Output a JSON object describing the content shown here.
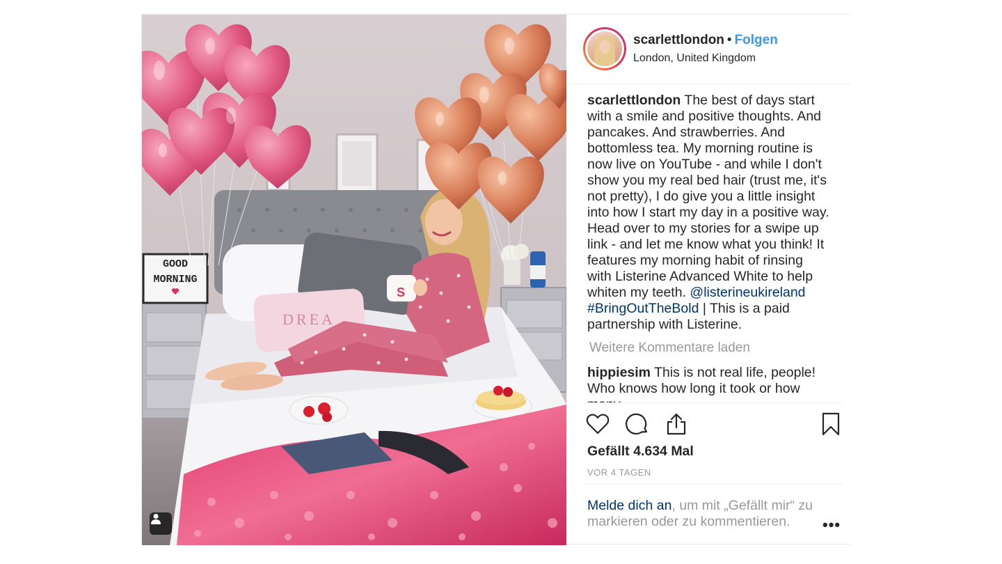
{
  "header": {
    "username": "scarlettlondon",
    "separator": "•",
    "follow_label": "Folgen",
    "location": "London, United Kingdom"
  },
  "caption": {
    "username": "scarlettlondon",
    "text": " The best of days start with a smile and positive thoughts. And pancakes. And strawberries. And bottomless tea. My morning routine is now live on YouTube - and while I don't show you my real bed hair (trust me, it's not pretty), I do give you a little insight into how I start my day in a positive way. Head over to my stories for a swipe up link - and let me know what you think! It features my morning habit of rinsing with Listerine Advanced White to help whiten my teeth. ",
    "mention": "@listerineukireland",
    "hashtag": "#BringOutTheBold",
    "suffix": " | This is a paid partnership with Listerine."
  },
  "load_more_label": "Weitere Kommentare laden",
  "comment": {
    "username": "hippiesim",
    "text": " This is not real life, people! Who knows how long it took or how many"
  },
  "photo": {
    "lightbox_line1": "GOOD",
    "lightbox_line2": "MORNING",
    "pillow_text": "DREA",
    "mug_text": "S"
  },
  "likes_text": "Gefällt 4.634 Mal",
  "time_text": "VOR 4 TAGEN",
  "login": {
    "link_text": "Melde dich an",
    "rest_text": ", um mit „Gefällt mir“ zu markieren oder zu kommentieren."
  },
  "more_options": "•••",
  "icons": {
    "like": "heart-icon",
    "comment": "comment-icon",
    "share": "share-icon",
    "save": "bookmark-icon",
    "tagged": "user-tag-icon"
  },
  "colors": {
    "follow": "#3897f0",
    "link": "#003569",
    "muted": "#999999",
    "text": "#262626"
  }
}
